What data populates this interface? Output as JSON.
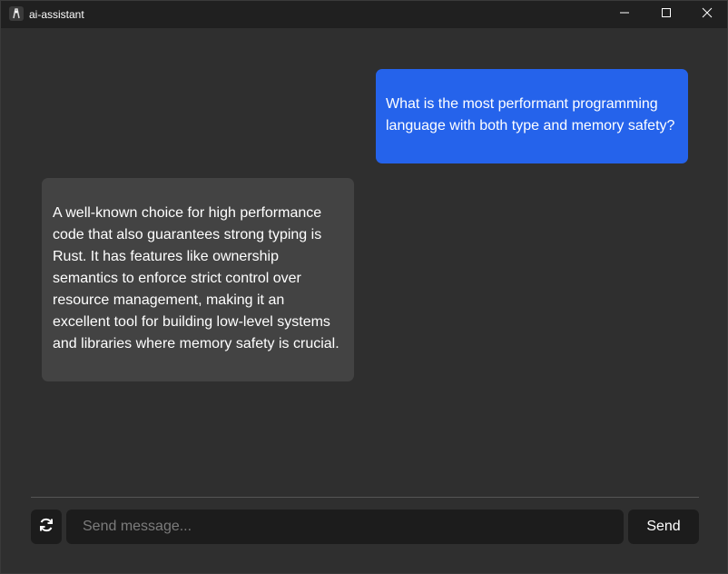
{
  "window": {
    "title": "ai-assistant",
    "icons": {
      "app": "app-logo-icon",
      "minimize": "minimize-icon",
      "maximize": "maximize-icon",
      "close": "close-icon"
    }
  },
  "messages": [
    {
      "role": "user",
      "text": "What is the most performant programming language with both type and memory safety?"
    },
    {
      "role": "assistant",
      "text": "A well-known choice for high performance code that also guarantees strong typing is Rust. It has features like ownership semantics to enforce strict control over resource management, making it an excellent tool for building low-level systems and libraries where memory safety is crucial."
    }
  ],
  "composer": {
    "refresh_icon": "refresh-icon",
    "placeholder": "Send message...",
    "value": "",
    "send_label": "Send"
  },
  "colors": {
    "background": "#2f2f2f",
    "titlebar": "#202020",
    "user_bubble": "#2563eb",
    "assistant_bubble": "#434343",
    "controls": "#1c1c1c"
  }
}
